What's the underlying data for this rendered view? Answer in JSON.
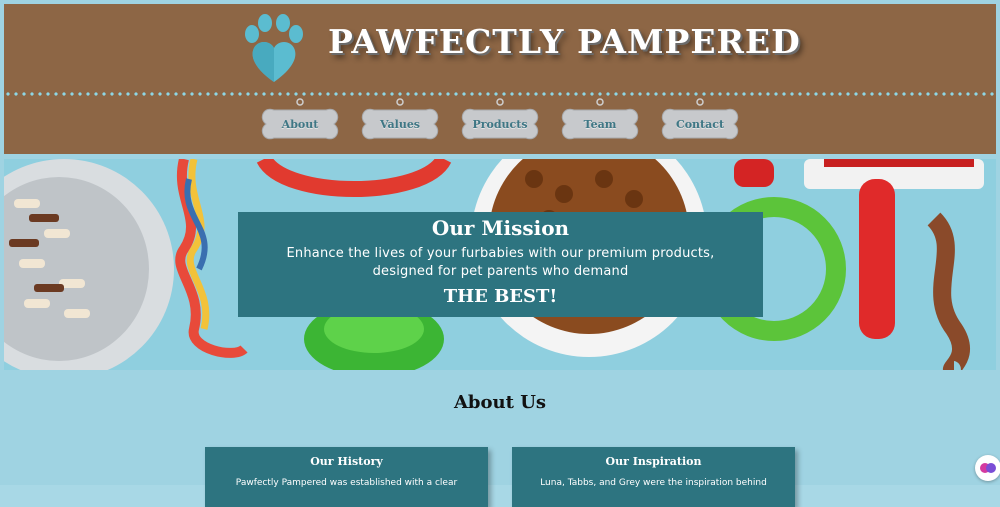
{
  "brand": {
    "name": "PAWFECTLY PAMPERED",
    "logo_icon": "paw-heart-icon"
  },
  "nav": {
    "items": [
      {
        "label": "About"
      },
      {
        "label": "Values"
      },
      {
        "label": "Products"
      },
      {
        "label": "Team"
      },
      {
        "label": "Contact"
      }
    ]
  },
  "hero": {
    "title": "Our Mission",
    "body": "Enhance the lives of your furbabies with our premium products, designed for pet parents who demand",
    "emphasis": "THE BEST!"
  },
  "about": {
    "title": "About Us",
    "cards": [
      {
        "title": "Our History",
        "text": "Pawfectly Pampered was established with a clear"
      },
      {
        "title": "Our Inspiration",
        "text": "Luna, Tabbs, and Grey were the inspiration behind"
      }
    ]
  },
  "colors": {
    "header_bg": "#8d6645",
    "accent_teal": "#2d7480",
    "page_bg": "#9fd3e2",
    "paw": "#5bbcd0"
  }
}
